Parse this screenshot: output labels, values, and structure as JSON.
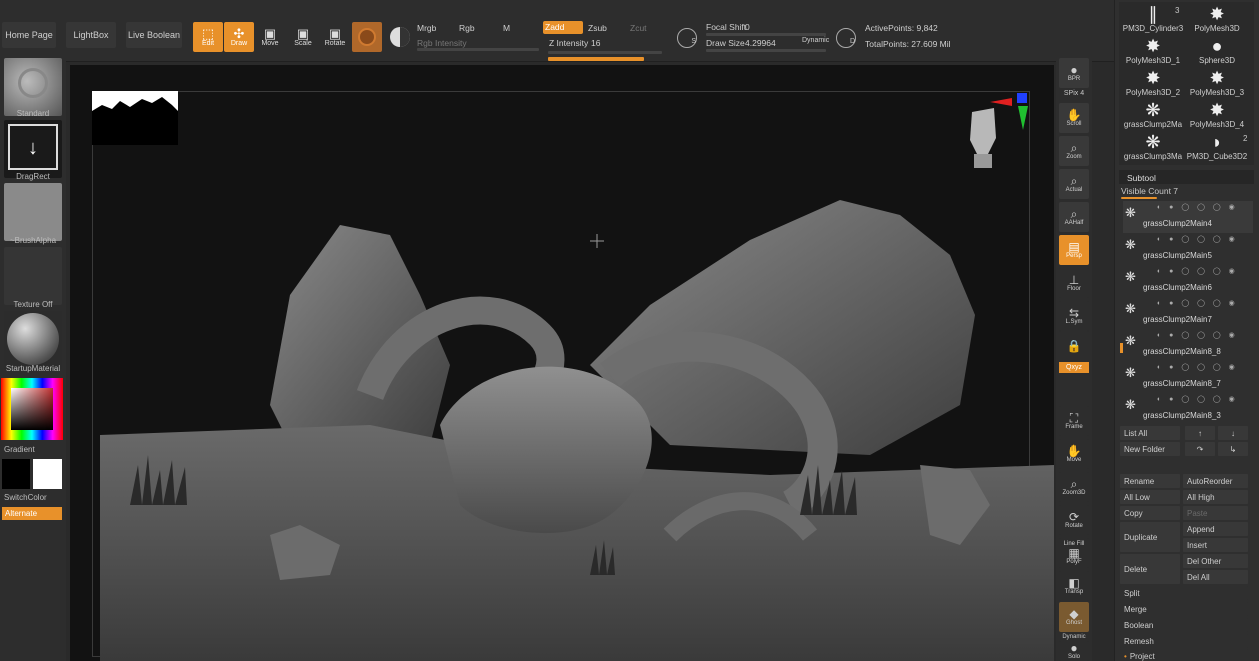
{
  "topbar": {
    "home_page": "Home Page",
    "lightbox": "LightBox",
    "live_boolean": "Live Boolean",
    "tools": [
      {
        "label": "Edit",
        "icon": "edit-icon",
        "active": true
      },
      {
        "label": "Draw",
        "icon": "draw-icon",
        "active": true
      },
      {
        "label": "Move",
        "icon": "move-icon",
        "active": false
      },
      {
        "label": "Scale",
        "icon": "scale-icon",
        "active": false
      },
      {
        "label": "Rotate",
        "icon": "rotate-icon",
        "active": false
      }
    ],
    "mrgb": "Mrgb",
    "rgb": "Rgb",
    "m": "M",
    "rgb_intensity": "Rgb Intensity",
    "zadd": "Zadd",
    "zsub": "Zsub",
    "zcut": "Zcut",
    "z_intensity": "Z Intensity",
    "z_intensity_value": "16",
    "focal_shift": "Focal Shift",
    "focal_shift_value": "0",
    "draw_size": "Draw Size",
    "draw_size_value": "4.29964",
    "dynamic": "Dynamic",
    "active_points": "ActivePoints: 9,842",
    "total_points": "TotalPoints: 27.609 Mil",
    "s_label": "S",
    "d_label": "D"
  },
  "leftshelf": {
    "brush": "Standard",
    "stroke": "DragRect",
    "alpha": "~BrushAlpha",
    "texture": "Texture Off",
    "material": "StartupMaterial",
    "gradient": "Gradient",
    "switch_color": "SwitchColor",
    "alternate": "Alternate"
  },
  "rightshelf": {
    "bpr": "BPR",
    "spix": "SPix 4",
    "scroll": "Scroll",
    "zoom": "Zoom",
    "actual": "Actual",
    "aahalf": "AAHalf",
    "persp": "Persp",
    "floor": "Floor",
    "lsym": "L.Sym",
    "xyz": "Qxyz",
    "frame": "Frame",
    "move": "Move",
    "zoom3d": "Zoom3D",
    "rotate": "Rotate",
    "line_fill": "Line Fill",
    "polyf": "PolyF",
    "transp": "Transp",
    "ghost": "Ghost",
    "dynamic_solo": "Dynamic",
    "solo": "Solo"
  },
  "toolpanel": {
    "items": [
      {
        "label": "PM3D_Cylinder3",
        "badge": "3",
        "icon": "cylinder-icon"
      },
      {
        "label": "PolyMesh3D",
        "badge": "",
        "icon": "star-icon"
      },
      {
        "label": "PolyMesh3D_1",
        "badge": "",
        "icon": "star-icon"
      },
      {
        "label": "Sphere3D",
        "badge": "",
        "icon": "sphere-icon"
      },
      {
        "label": "PolyMesh3D_2",
        "badge": "",
        "icon": "star-icon"
      },
      {
        "label": "PolyMesh3D_3",
        "badge": "",
        "icon": "star-icon"
      },
      {
        "label": "grassClump2Ma",
        "badge": "",
        "icon": "grass-icon"
      },
      {
        "label": "PolyMesh3D_4",
        "badge": "",
        "icon": "star-icon"
      },
      {
        "label": "grassClump3Ma",
        "badge": "",
        "icon": "grass-icon"
      },
      {
        "label": "PM3D_Cube3D2",
        "badge": "2",
        "icon": "cube-icon"
      }
    ]
  },
  "subtool": {
    "title": "Subtool",
    "visible_count": "Visible Count 7",
    "rows": [
      {
        "name": "grassClump2Main4"
      },
      {
        "name": "grassClump2Main5"
      },
      {
        "name": "grassClump2Main6"
      },
      {
        "name": "grassClump2Main7"
      },
      {
        "name": "grassClump2Main8_8"
      },
      {
        "name": "grassClump2Main8_7"
      },
      {
        "name": "grassClump2Main8_3"
      }
    ],
    "list_all": "List All",
    "new_folder": "New Folder",
    "rename": "Rename",
    "auto_reorder": "AutoReorder",
    "all_low": "All Low",
    "all_high": "All High",
    "copy": "Copy",
    "paste": "Paste",
    "duplicate": "Duplicate",
    "append": "Append",
    "insert": "Insert",
    "delete": "Delete",
    "del_other": "Del Other",
    "del_all": "Del All",
    "split": "Split",
    "merge": "Merge",
    "boolean": "Boolean",
    "remesh": "Remesh",
    "project": "Project"
  }
}
